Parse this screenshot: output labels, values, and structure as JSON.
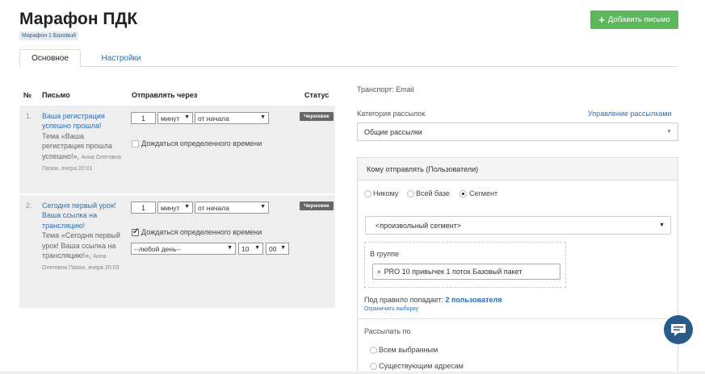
{
  "header": {
    "title": "Марафон ПДК",
    "badge": "Марафон 1 Базовый",
    "add_button": "Добавить письмо"
  },
  "tabs": [
    {
      "label": "Основное",
      "active": true
    },
    {
      "label": "Настройки",
      "active": false
    }
  ],
  "table": {
    "columns": [
      "№",
      "Письмо",
      "Отправлять через",
      "Статус"
    ],
    "rows": [
      {
        "num": "1.",
        "name": "Ваша регистрация успешно прошла!",
        "subject": "Тема «Ваша регистрация прошла успешно!»,",
        "meta": "Анна Олеговна Пазюк, вчера 20:01",
        "amount": "1",
        "unit": "минут",
        "from": "от начала",
        "wait_label": "Дождаться определенного времени",
        "wait_checked": false,
        "status": "Черновик"
      },
      {
        "num": "2.",
        "name": "Сегодня первый урок! Ваша ссылка на трансляцию!",
        "subject": "Тема «Сегодня первый урок! Ваша ссылка на трансляцию!»,",
        "meta": "Анна Олеговна Пазюк, вчера 20:03",
        "amount": "1",
        "unit": "минут",
        "from": "от начала",
        "wait_label": "Дождаться определенного времени",
        "wait_checked": true,
        "day": "--любой день--",
        "hour": "10",
        "minute": "00",
        "status": "Черновик"
      }
    ]
  },
  "right": {
    "transport": "Транспорт: Email",
    "category_label": "Категория рассылок",
    "manage_link": "Управление рассылками",
    "category_value": "Общие рассылки",
    "recipients_header": "Кому отправлять (Пользователи)",
    "radios": [
      {
        "label": "Никому",
        "checked": false
      },
      {
        "label": "Всей базе",
        "checked": false
      },
      {
        "label": "Сегмент",
        "checked": true
      }
    ],
    "segment_value": "<произвольный сегмент>",
    "group_label": "В группе",
    "group_tag": "PRO 10 привычек 1 поток Базовый пакет",
    "rule_text": "Под правило попадает:",
    "rule_count": "2 пользователя",
    "limit_link": "Ограничить выборку",
    "send_by_label": "Рассылать по",
    "send_by_options": [
      {
        "label": "Всем выбранным",
        "checked": false
      },
      {
        "label": "Существующим адресам",
        "checked": false
      }
    ]
  },
  "colors": {
    "accent_green": "#5cb85c",
    "link_blue": "#2a6fb5",
    "status_gray": "#666666",
    "chat_button": "#2a5a88"
  }
}
